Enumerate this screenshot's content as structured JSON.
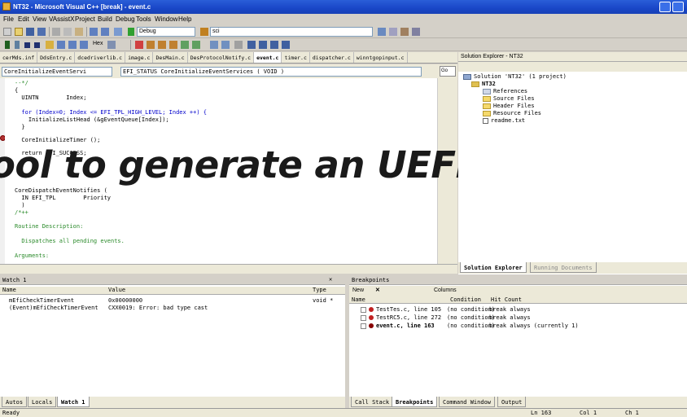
{
  "window": {
    "title": "NT32 - Microsoft Visual C++ [break] - event.c"
  },
  "menu": [
    "File",
    "Edit",
    "View",
    "VAssistX",
    "Project",
    "Build",
    "Debug",
    "Tools",
    "Window",
    "Help"
  ],
  "toolbar": {
    "hex_label": "Hex",
    "config": "Debug",
    "find_value": "sci"
  },
  "tabs": [
    "cerMds.inf",
    "DdsEntry.c",
    "dcedriverlib.c",
    "image.c",
    "DesMain.c",
    "DesProtocolNotify.c",
    "event.c",
    "timer.c",
    "dispatcher.c",
    "winntgopinput.c"
  ],
  "active_tab": "event.c",
  "nav": {
    "scope": "CoreInitializeEventServi",
    "signature": "EFI_STATUS CoreInitializeEventServices ( VOID )",
    "go": "Go"
  },
  "code": [
    "--*/",
    "{",
    "  UINTN        Index;",
    "",
    "  for (Index=0; Index <= EFI_TPL_HIGH_LEVEL; Index ++) {",
    "    InitializeListHead (&gEventQueue[Index]);",
    "  }",
    "",
    "  CoreInitializeTimer ();",
    "",
    "  return EFI_SUCCESS;",
    "",
    "",
    "",
    "VOID",
    "CoreDispatchEventNotifies (",
    "  IN EFI_TPL        Priority",
    "  )",
    "/*++",
    "",
    "Routine Description:",
    "",
    "  Dispatches all pending events.",
    "",
    "Arguments:"
  ],
  "overlay_text": "ool to generate an UEFI",
  "solution_explorer": {
    "title": "Solution Explorer - NT32",
    "solution": "Solution 'NT32' (1 project)",
    "project": "NT32",
    "items": [
      "References",
      "Source Files",
      "Header Files",
      "Resource Files",
      "readme.txt"
    ],
    "tabs": [
      "Solution Explorer",
      "Running Documents"
    ]
  },
  "watch": {
    "title": "Watch 1",
    "columns": [
      "Name",
      "Value",
      "Type"
    ],
    "rows": [
      {
        "name": "mEfiCheckTimerEvent",
        "value": "0x00000000",
        "type": "void *"
      },
      {
        "name": "(Event)mEfiCheckTimerEvent",
        "value": "CXX0019: Error: bad type cast",
        "type": ""
      }
    ],
    "tabs": [
      "Autos",
      "Locals",
      "Watch 1"
    ]
  },
  "breakpoints": {
    "title": "Breakpoints",
    "new_label": "New",
    "columns_label": "Columns",
    "columns": [
      "Name",
      "Condition",
      "Hit Count"
    ],
    "rows": [
      {
        "name": "TestTes.c, line 105",
        "condition": "(no condition)",
        "hit": "break always"
      },
      {
        "name": "TestRC5.c, line 272",
        "condition": "(no condition)",
        "hit": "break always"
      },
      {
        "name": "event.c, line 163",
        "condition": "(no condition)",
        "hit": "break always (currently 1)"
      }
    ],
    "tabs": [
      "Call Stack",
      "Breakpoints",
      "Command Window",
      "Output"
    ]
  },
  "status": {
    "text": "Ready",
    "line": "Ln 163",
    "col": "Col 1",
    "ch": "Ch 1"
  },
  "colors": {
    "title": "#1946c7",
    "breakpoint": "#c02020"
  }
}
